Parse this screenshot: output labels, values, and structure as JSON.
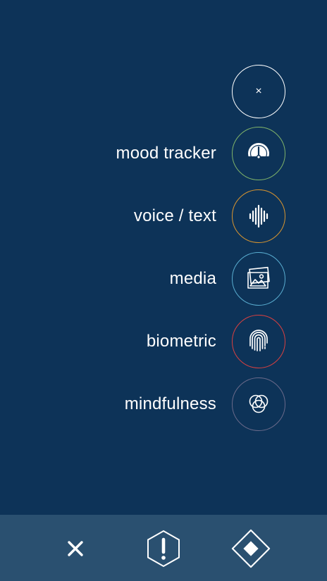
{
  "menu": {
    "close_glyph": "×",
    "items": [
      {
        "label": "mood tracker",
        "icon": "gauge-icon",
        "color": "#7fb36a"
      },
      {
        "label": "voice / text",
        "icon": "waveform-icon",
        "color": "#d9952f"
      },
      {
        "label": "media",
        "icon": "photos-icon",
        "color": "#5aaed1"
      },
      {
        "label": "biometric",
        "icon": "fingerprint-icon",
        "color": "#d94040"
      },
      {
        "label": "mindfulness",
        "icon": "overlapping-circles-icon",
        "color": "#6a6a8a"
      }
    ]
  },
  "bottom_bar": {
    "buttons": [
      {
        "icon": "close-icon"
      },
      {
        "icon": "alert-hexagon-icon"
      },
      {
        "icon": "diamond-icon"
      }
    ]
  },
  "colors": {
    "background": "#0d3358",
    "bottom_bar": "#2a5070"
  }
}
